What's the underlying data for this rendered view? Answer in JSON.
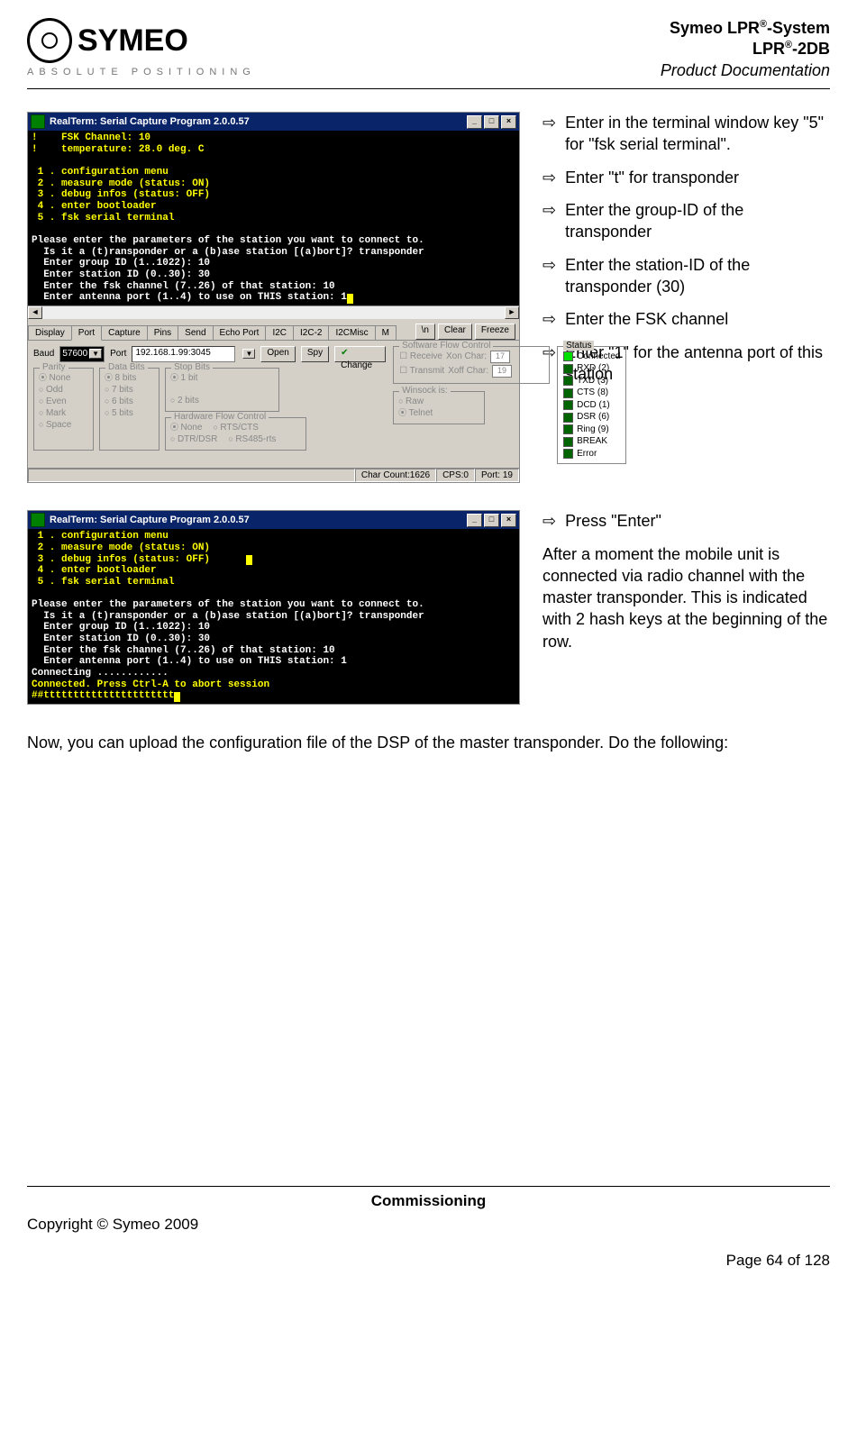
{
  "header": {
    "logo_text": "SYMEO",
    "tagline": "ABSOLUTE POSITIONING",
    "doc_line1_a": "Symeo LPR",
    "doc_line1_b": "-System",
    "doc_line2_a": "LPR",
    "doc_line2_b": "-2DB",
    "doc_line3": "Product Documentation",
    "sup": "®"
  },
  "win": {
    "title": "RealTerm: Serial Capture Program 2.0.0.57",
    "min": "_",
    "max": "□",
    "close": "×"
  },
  "term1": [
    "!    FSK Channel: 10",
    "!    temperature: 28.0 deg. C",
    "",
    " 1 . configuration menu",
    " 2 . measure mode (status: ON)",
    " 3 . debug infos (status: OFF)",
    " 4 . enter bootloader",
    " 5 . fsk serial terminal",
    ""
  ],
  "term1_white": [
    "Please enter the parameters of the station you want to connect to.",
    "  Is it a (t)ransponder or a (b)ase station [(a)bort]? transponder",
    "  Enter group ID (1..1022): 10",
    "  Enter station ID (0..30): 30",
    "  Enter the fsk channel (7..26) of that station: 10",
    "  Enter antenna port (1..4) to use on THIS station: 1"
  ],
  "tabs": {
    "items": [
      "Display",
      "Port",
      "Capture",
      "Pins",
      "Send",
      "Echo Port",
      "I2C",
      "I2C-2",
      "I2CMisc",
      "M"
    ],
    "active": 1,
    "btn_n": "\\n",
    "btn_clear": "Clear",
    "btn_freeze": "Freeze"
  },
  "panel": {
    "baud_label": "Baud",
    "baud_value": "57600",
    "port_label": "Port",
    "port_value": "192.168.1.99:3045",
    "open": "Open",
    "spy": "Spy",
    "change": "Change",
    "checkmark": "✔",
    "parity_legend": "Parity",
    "parity_opts": [
      "None",
      "Odd",
      "Even",
      "Mark",
      "Space"
    ],
    "databits_legend": "Data Bits",
    "databits_opts": [
      "8 bits",
      "7 bits",
      "6 bits",
      "5 bits"
    ],
    "stopbits_legend": "Stop Bits",
    "stopbits_opts": [
      "1 bit",
      "2 bits"
    ],
    "hwflow_legend": "Hardware Flow Control",
    "hwflow_opts": [
      "None",
      "RTS/CTS",
      "DTR/DSR",
      "RS485-rts"
    ],
    "swflow_legend": "Software Flow Control",
    "sw_receive": "Receive",
    "sw_transmit": "Transmit",
    "xon_label": "Xon Char:",
    "xoff_label": "Xoff Char:",
    "xon_val": "17",
    "xoff_val": "19",
    "winsock_legend": "Winsock is:",
    "winsock_opts": [
      "Raw",
      "Telnet"
    ]
  },
  "status": {
    "legend": "Status",
    "items": [
      {
        "label": "Connected",
        "on": true
      },
      {
        "label": "RXD (2)",
        "on": false
      },
      {
        "label": "TXD (3)",
        "on": false
      },
      {
        "label": "CTS (8)",
        "on": false
      },
      {
        "label": "DCD (1)",
        "on": false
      },
      {
        "label": "DSR (6)",
        "on": false
      },
      {
        "label": "Ring (9)",
        "on": false
      },
      {
        "label": "BREAK",
        "on": false
      },
      {
        "label": "Error",
        "on": false
      }
    ]
  },
  "statusbar": {
    "charcount": "Char Count:1626",
    "cps": "CPS:0",
    "port": "Port: 19"
  },
  "instructions1": [
    "Enter in the terminal window key \"5\" for \"fsk serial terminal\".",
    "Enter \"t\" for transponder",
    "Enter the group-ID of the transponder",
    "Enter the station-ID of the transponder (30)",
    "Enter the FSK channel",
    "Enter \"1\" for the antenna port of this station"
  ],
  "term2_y": [
    " 1 . configuration menu",
    " 2 . measure mode (status: ON)",
    " 3 . debug infos (status: OFF)",
    " 4 . enter bootloader",
    " 5 . fsk serial terminal",
    ""
  ],
  "term2_w": [
    "Please enter the parameters of the station you want to connect to.",
    "  Is it a (t)ransponder or a (b)ase station [(a)bort]? transponder",
    "  Enter group ID (1..1022): 10",
    "  Enter station ID (0..30): 30",
    "  Enter the fsk channel (7..26) of that station: 10",
    "  Enter antenna port (1..4) to use on THIS station: 1",
    "Connecting ............"
  ],
  "term2_y2": [
    "Connected. Press Ctrl-A to abort session",
    "##tttttttttttttttttttttt"
  ],
  "instructions2_bullet": "Press \"Enter\"",
  "instructions2_para": "After a moment the mobile unit is connected via radio channel with the master transponder. This is indicated with 2 hash keys at the beginning of the row.",
  "body_para": "Now, you can upload the configuration file of the DSP of the master transponder. Do the following:",
  "footer": {
    "section": "Commissioning",
    "copyright": "Copyright © Symeo 2009",
    "page": "Page 64 of 128"
  },
  "arrow": "⇨"
}
